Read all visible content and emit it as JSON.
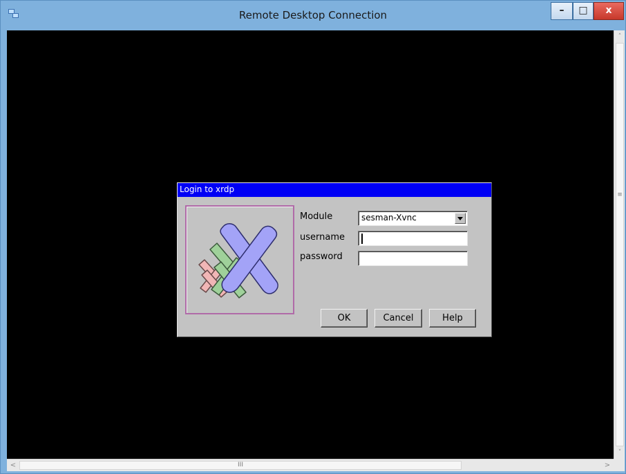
{
  "window": {
    "title": "Remote Desktop Connection",
    "controls": {
      "minimize": "–",
      "maximize": "□",
      "close": "x"
    }
  },
  "scrollbars": {
    "vertical": {
      "up": "˄",
      "down": "˅",
      "grip": "≡"
    },
    "horizontal": {
      "left": "<",
      "right": ">",
      "grip": "III"
    }
  },
  "dialog": {
    "title": "Login to xrdp",
    "labels": {
      "module": "Module",
      "username": "username",
      "password": "password"
    },
    "module": {
      "selected": "sesman-Xvnc"
    },
    "username": {
      "value": ""
    },
    "password": {
      "value": ""
    },
    "buttons": {
      "ok": "OK",
      "cancel": "Cancel",
      "help": "Help"
    }
  },
  "colors": {
    "titlebar": "#7fb1dd",
    "remote_bg": "#000000",
    "dialog_bg": "#c3c3c3",
    "dialog_title": "#0000f5",
    "logo_blue": "#a3a3f7",
    "logo_green": "#9fd19a",
    "logo_pink": "#f1b6b6"
  },
  "icons": {
    "app": "remote-desktop-icon",
    "logo": "xrdp-logo"
  }
}
